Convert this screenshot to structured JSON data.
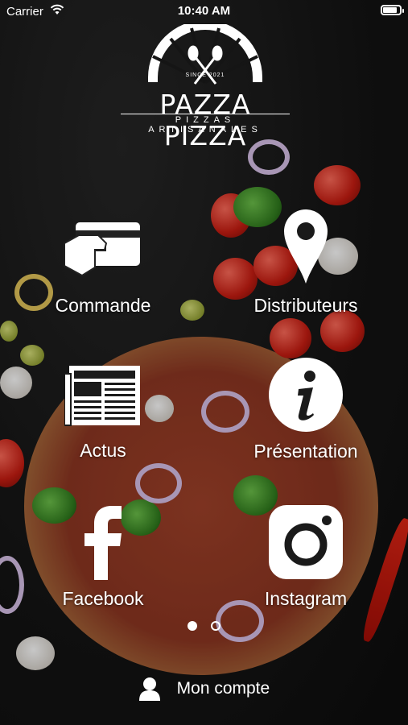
{
  "status_bar": {
    "carrier": "Carrier",
    "time": "10:40 AM",
    "icons": [
      "wifi-icon",
      "battery-icon"
    ]
  },
  "logo": {
    "since": "SINCE 2021",
    "brand": "PAZZA PIZZA",
    "tagline": "PIZZAS ARTISANALES"
  },
  "menu": [
    {
      "id": "commande",
      "label": "Commande",
      "icon": "card-payment-icon"
    },
    {
      "id": "distributeurs",
      "label": "Distributeurs",
      "icon": "map-pin-icon"
    },
    {
      "id": "actus",
      "label": "Actus",
      "icon": "newspaper-icon"
    },
    {
      "id": "presentation",
      "label": "Présentation",
      "icon": "info-icon"
    },
    {
      "id": "facebook",
      "label": "Facebook",
      "icon": "facebook-icon"
    },
    {
      "id": "instagram",
      "label": "Instagram",
      "icon": "instagram-icon"
    }
  ],
  "pager": {
    "pages": 2,
    "active": 1
  },
  "footer": {
    "account_label": "Mon compte",
    "icon": "user-icon"
  },
  "colors": {
    "text": "#ffffff",
    "background": "#151515"
  }
}
